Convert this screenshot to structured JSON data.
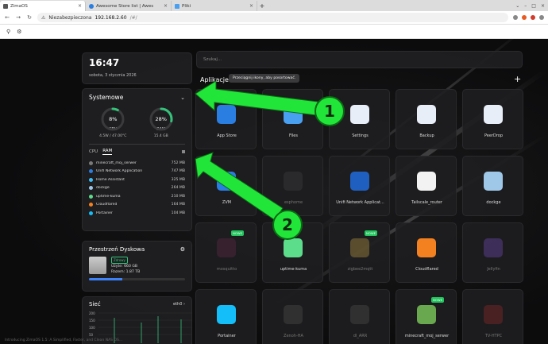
{
  "browser": {
    "tabs": [
      {
        "title": "ZimaOS",
        "active": true
      },
      {
        "title": "Awesome Store list | Awes",
        "active": false
      },
      {
        "title": "Pliki",
        "active": false
      }
    ],
    "security_label": "Niezabezpieczona",
    "url_host": "192.168.2.60",
    "url_path": "/#/"
  },
  "clock": {
    "time": "16:47",
    "date": "sobota, 3 stycznia 2026"
  },
  "system": {
    "title": "Systemowe",
    "cpu": {
      "percent": 8,
      "value_label": "8%",
      "label": "CPU",
      "sub": "4.5W / 47.00°C",
      "color": "#35c37a"
    },
    "ram": {
      "percent": 28,
      "value_label": "28%",
      "label": "RAM",
      "sub": "15.4 GB",
      "color": "#35c37a"
    },
    "tab_cpu": "CPU",
    "tab_ram": "RAM",
    "processes": [
      {
        "name": "minecraft_moj_serwer",
        "mem": "752 MB",
        "color": "#7a7a7a"
      },
      {
        "name": "Unifi Network Application",
        "mem": "747 MB",
        "color": "#2a7de1"
      },
      {
        "name": "Home Assistant",
        "mem": "325 MB",
        "color": "#41bdf5"
      },
      {
        "name": "dockge",
        "mem": "264 MB",
        "color": "#9fc8e8"
      },
      {
        "name": "uptime-kuma",
        "mem": "210 MB",
        "color": "#5cdd8b"
      },
      {
        "name": "Cloudflared",
        "mem": "164 MB",
        "color": "#f48120"
      },
      {
        "name": "Portainer",
        "mem": "104 MB",
        "color": "#13bef9"
      }
    ]
  },
  "disk": {
    "title": "Przestrzeń Dyskowa",
    "status": "Zdrowy",
    "used": "Użyte: 660 GB",
    "total": "Razem: 1.87 TB",
    "used_fraction": 0.35
  },
  "network": {
    "title": "Sieć",
    "iface": "eth0",
    "yticks": [
      "200",
      "150",
      "100",
      "50"
    ]
  },
  "search": {
    "placeholder": "Szukaj..."
  },
  "apps": {
    "title": "Aplikacje",
    "tooltip": "Przeciągnij ikony, aby posortować.",
    "items": [
      {
        "name": "App Store",
        "color": "#2a7de1",
        "dim": false,
        "new": false
      },
      {
        "name": "Files",
        "color": "#4aa0f0",
        "dim": false,
        "new": false
      },
      {
        "name": "Settings",
        "color": "#e8eef8",
        "dim": false,
        "new": false
      },
      {
        "name": "Backup",
        "color": "#e8eef8",
        "dim": false,
        "new": false
      },
      {
        "name": "PeerDrop",
        "color": "#e8eef8",
        "dim": false,
        "new": false
      },
      {
        "name": "ZVM",
        "color": "#2a7de1",
        "dim": false,
        "new": false
      },
      {
        "name": "esphome",
        "color": "#444444",
        "dim": true,
        "new": false
      },
      {
        "name": "Unifi Network Applicat...",
        "color": "#1f5fbf",
        "dim": false,
        "new": false
      },
      {
        "name": "Tailscale_router",
        "color": "#f2f2f2",
        "dim": false,
        "new": false
      },
      {
        "name": "dockge",
        "color": "#9fc8e8",
        "dim": false,
        "new": false
      },
      {
        "name": "mosquitto",
        "color": "#6b2a4a",
        "dim": true,
        "new": true
      },
      {
        "name": "uptime-kuma",
        "color": "#5cdd8b",
        "dim": false,
        "new": false
      },
      {
        "name": "zigbee2mqtt",
        "color": "#caa84a",
        "dim": true,
        "new": true
      },
      {
        "name": "Cloudflared",
        "color": "#f48120",
        "dim": false,
        "new": false
      },
      {
        "name": "Jellyfin",
        "color": "#7a4fc8",
        "dim": true,
        "new": false
      },
      {
        "name": "Portainer",
        "color": "#13bef9",
        "dim": false,
        "new": false
      },
      {
        "name": "Zenoh-HA",
        "color": "#555555",
        "dim": true,
        "new": false
      },
      {
        "name": "dl_ARR",
        "color": "#555555",
        "dim": true,
        "new": false
      },
      {
        "name": "minecraft_moj_serwer",
        "color": "#6aa84f",
        "dim": false,
        "new": true
      },
      {
        "name": "TV-HTPC",
        "color": "#a02a2a",
        "dim": true,
        "new": false
      }
    ]
  },
  "annotations": {
    "marker1": "1",
    "marker2": "2",
    "arrow_color": "#22e53a"
  },
  "footer": "Introducing ZimaOS 1.5: A Simplified, Faster, and Clean NAS OS..."
}
